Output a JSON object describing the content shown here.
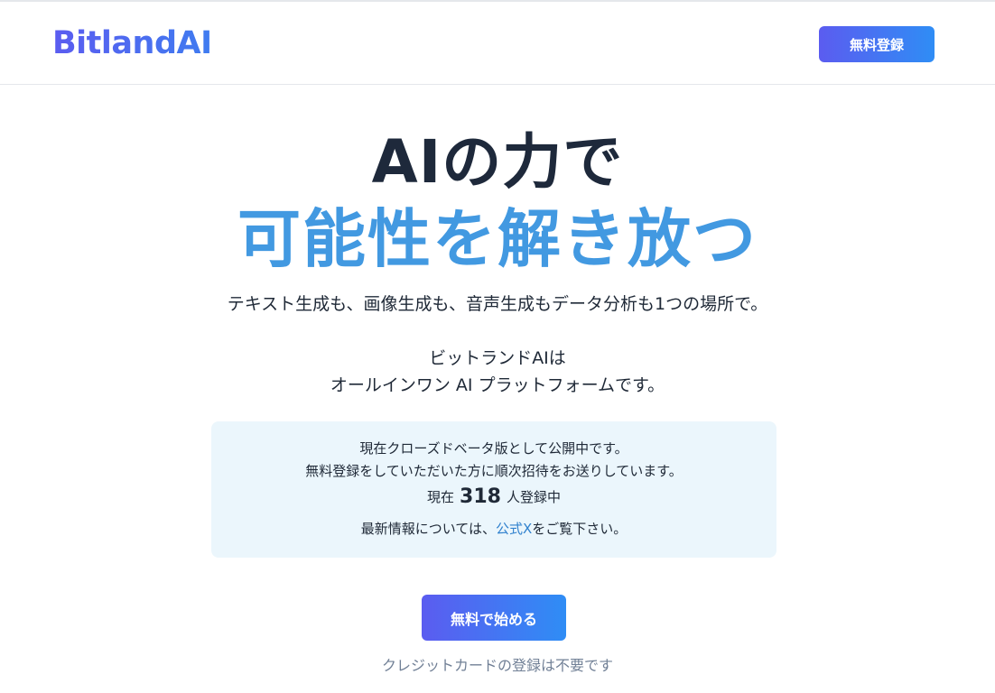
{
  "header": {
    "logo": "BitlandAI",
    "signup_label": "無料登録"
  },
  "hero": {
    "line1": "AIの力で",
    "line2": "可能性を解き放つ",
    "tagline": "テキスト生成も、画像生成も、音声生成もデータ分析も1つの場所で。",
    "intro_line1": "ビットランドAIは",
    "intro_line2": "オールインワン AI プラットフォームです。"
  },
  "info": {
    "line1": "現在クローズドベータ版として公開中です。",
    "line2": "無料登録をしていただいた方に順次招待をお送りしています。",
    "count_prefix": "現在",
    "count_value": "318",
    "count_suffix": "人登録中",
    "news_prefix": "最新情報については、",
    "news_link": "公式X",
    "news_suffix": "をご覧下さい。"
  },
  "cta": {
    "button_label": "無料で始める",
    "note": "クレジットカードの登録は不要です"
  },
  "colors": {
    "accent_blue": "#4299e1",
    "gradient_start": "#5b5cf0",
    "gradient_end": "#2f8df5",
    "info_bg": "#ebf6fc",
    "link": "#3182ce"
  }
}
